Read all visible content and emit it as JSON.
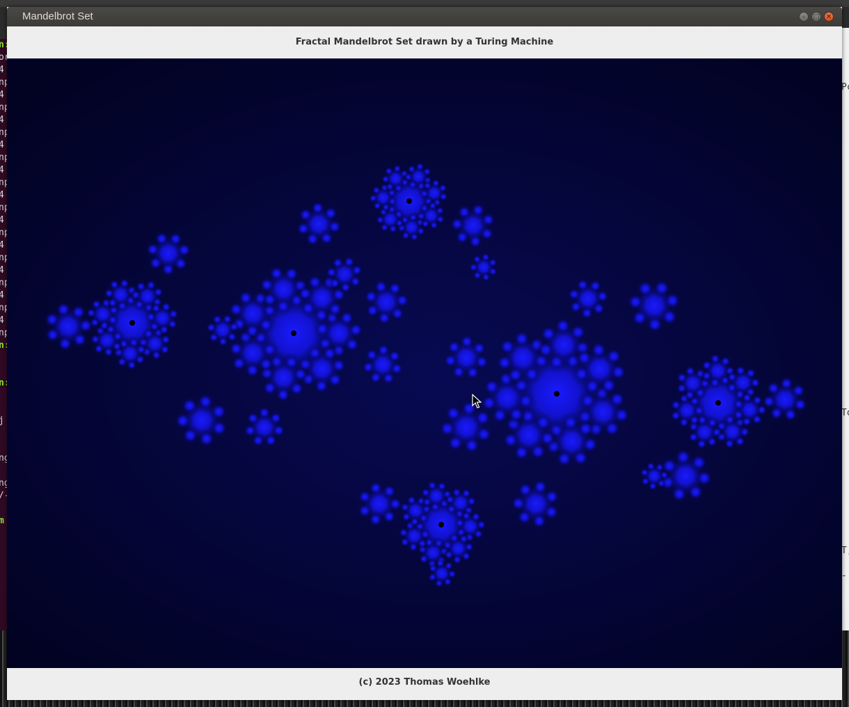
{
  "window": {
    "title": "Mandelbrot Set",
    "header_text": "Fractal Mandelbrot Set drawn by a Turing Machine",
    "footer_text": "(c) 2023 Thomas Woehlke",
    "controls": {
      "minimize_icon": "minimize-icon",
      "maximize_icon": "maximize-icon",
      "close_icon": "close-icon"
    }
  },
  "canvas": {
    "description_icon": "julia-fractal-image",
    "colors": {
      "background": "#03042c",
      "fractal": "#1a1aff",
      "core": "#000000"
    }
  },
  "background_terminal": {
    "lines": [
      {
        "t": "n:",
        "c": "g"
      },
      {
        "t": "or",
        "c": ""
      },
      {
        "t": " 4",
        "c": ""
      },
      {
        "t": "np",
        "c": ""
      },
      {
        "t": " 4",
        "c": ""
      },
      {
        "t": "np",
        "c": ""
      },
      {
        "t": " 4",
        "c": ""
      },
      {
        "t": "np",
        "c": ""
      },
      {
        "t": " 4",
        "c": ""
      },
      {
        "t": "np",
        "c": ""
      },
      {
        "t": " 4",
        "c": ""
      },
      {
        "t": "np",
        "c": ""
      },
      {
        "t": " 4",
        "c": ""
      },
      {
        "t": "np",
        "c": ""
      },
      {
        "t": " 4",
        "c": ""
      },
      {
        "t": "np",
        "c": ""
      },
      {
        "t": " 4",
        "c": ""
      },
      {
        "t": "np",
        "c": ""
      },
      {
        "t": " 4",
        "c": ""
      },
      {
        "t": "np",
        "c": ""
      },
      {
        "t": " 4",
        "c": ""
      },
      {
        "t": "np",
        "c": ""
      },
      {
        "t": " 4",
        "c": ""
      },
      {
        "t": "np",
        "c": ""
      },
      {
        "t": "n:",
        "c": "g"
      },
      {
        "t": "",
        "c": ""
      },
      {
        "t": "",
        "c": ""
      },
      {
        "t": "n:",
        "c": "g"
      },
      {
        "t": "",
        "c": ""
      },
      {
        "t": "",
        "c": ""
      },
      {
        "t": " j",
        "c": ""
      },
      {
        "t": "",
        "c": ""
      },
      {
        "t": "",
        "c": ""
      },
      {
        "t": "ng",
        "c": ""
      },
      {
        "t": "",
        "c": ""
      },
      {
        "t": "ng",
        "c": ""
      },
      {
        "t": "/-",
        "c": ""
      },
      {
        "t": "",
        "c": ""
      },
      {
        "t": "m",
        "c": "g"
      }
    ],
    "right_fragments": [
      "Pc",
      "To",
      "T;",
      "-."
    ]
  }
}
